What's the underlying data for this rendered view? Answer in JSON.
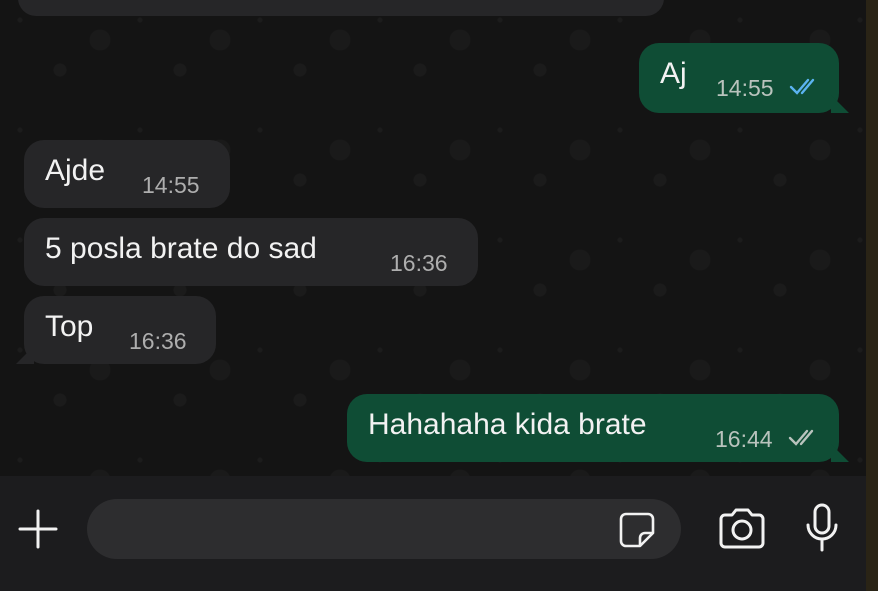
{
  "messages": [
    {
      "id": "m1",
      "direction": "out",
      "text": "Aj",
      "time": "14:55",
      "status": "read"
    },
    {
      "id": "m2",
      "direction": "in",
      "text": "Ajde",
      "time": "14:55"
    },
    {
      "id": "m3",
      "direction": "in",
      "text": "5 posla brate do sad",
      "time": "16:36"
    },
    {
      "id": "m4",
      "direction": "in",
      "text": "Top",
      "time": "16:36"
    },
    {
      "id": "m5",
      "direction": "out",
      "text": "Hahahaha kida brate",
      "time": "16:44",
      "status": "delivered"
    }
  ],
  "composer": {
    "placeholder": "",
    "icons": {
      "attach": "plus-icon",
      "sticker": "sticker-icon",
      "camera": "camera-icon",
      "voice": "microphone-icon"
    }
  },
  "colors": {
    "outgoing_bubble": "#0f4d35",
    "incoming_bubble": "#262628",
    "read_tick": "#5bb3f0",
    "delivered_tick": "#b9c3bd"
  }
}
